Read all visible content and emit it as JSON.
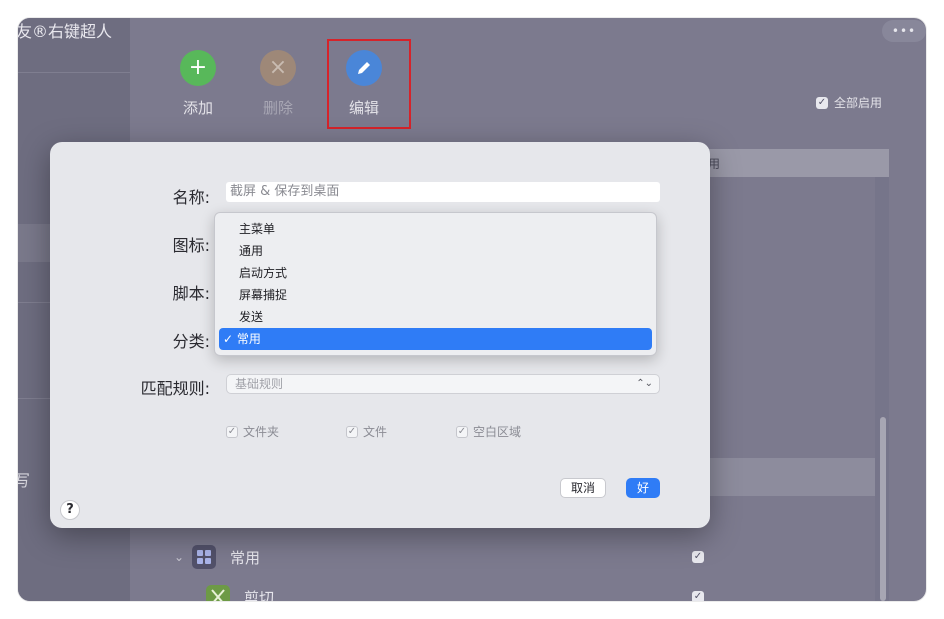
{
  "app": {
    "sidebar_title": "友®右键超人",
    "sidebar_label": "写",
    "more_label": "•••"
  },
  "toolbar": {
    "add_label": "添加",
    "delete_label": "删除",
    "edit_label": "编辑",
    "enable_all_label": "全部启用"
  },
  "list": {
    "header_partial": "用",
    "rows": [
      {
        "label": "常用",
        "checked": true
      },
      {
        "label": "剪切",
        "checked": true
      }
    ]
  },
  "dialog": {
    "name_label": "名称:",
    "name_placeholder": "截屏 & 保存到桌面",
    "icon_label": "图标:",
    "script_label": "脚本:",
    "category_label": "分类:",
    "match_label": "匹配规则:",
    "match_value": "基础规则",
    "options": [
      "文件夹",
      "文件",
      "空白区域"
    ],
    "cancel_label": "取消",
    "ok_label": "好",
    "help_label": "?"
  },
  "category_menu": {
    "items": [
      "主菜单",
      "通用",
      "启动方式",
      "屏幕捕捉",
      "发送",
      "常用"
    ],
    "selected": "常用"
  },
  "colors": {
    "accent": "#2f7cf6",
    "add_green": "#58b85a",
    "delete_orange": "#9e8878",
    "edit_blue": "#4a86d8",
    "highlight_red": "#d6232a"
  }
}
